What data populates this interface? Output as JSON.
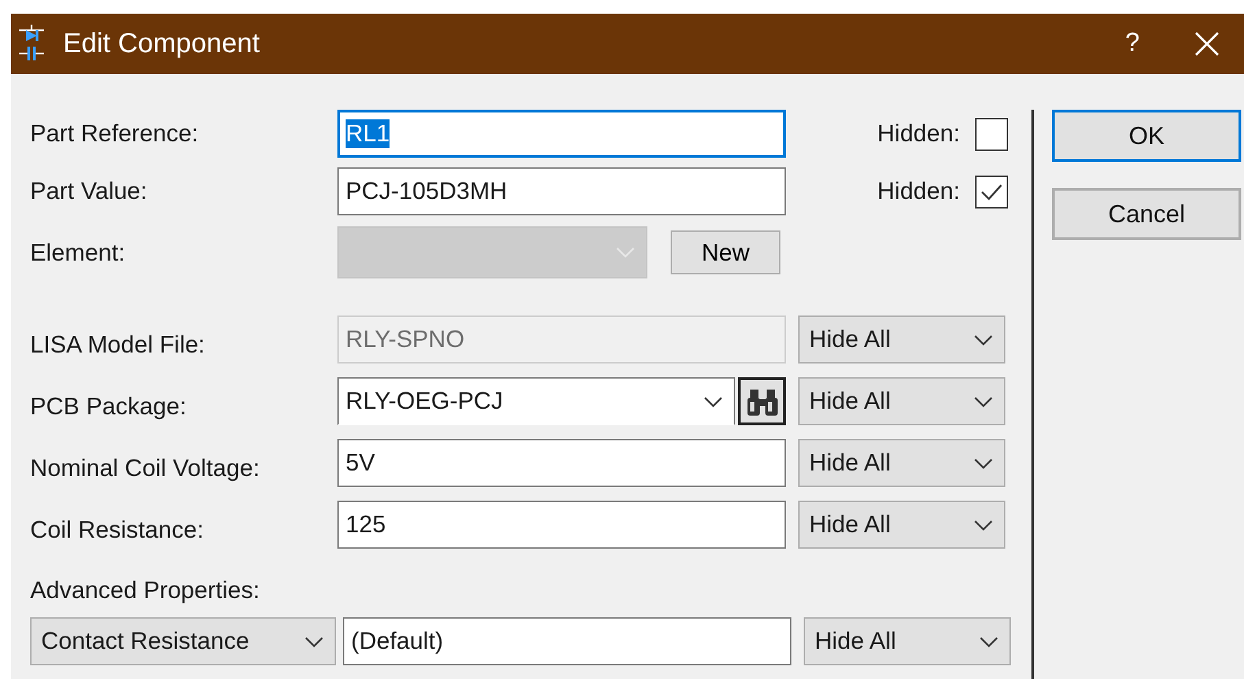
{
  "window": {
    "title": "Edit Component",
    "help": "?"
  },
  "top_rows": [
    {
      "label": "Part Reference:",
      "value": "RL1",
      "focused": true,
      "text_selected": true,
      "hidden_label": "Hidden:",
      "hidden": false
    },
    {
      "label": "Part Value:",
      "value": "PCJ-105D3MH",
      "focused": false,
      "text_selected": false,
      "hidden_label": "Hidden:",
      "hidden": true
    }
  ],
  "element": {
    "label": "Element:",
    "disabled": true,
    "button": "New"
  },
  "properties": [
    {
      "kind": "readonly",
      "label": "LISA Model File:",
      "value": "RLY-SPNO",
      "visibility": "Hide All"
    },
    {
      "kind": "package",
      "label": "PCB Package:",
      "value": "RLY-OEG-PCJ",
      "visibility": "Hide All"
    },
    {
      "kind": "text",
      "label": "Nominal Coil Voltage:",
      "value": "5V",
      "visibility": "Hide All"
    },
    {
      "kind": "text",
      "label": "Coil Resistance:",
      "value": "125",
      "visibility": "Hide All"
    }
  ],
  "advanced": {
    "label": "Advanced Properties:",
    "property": "Contact Resistance",
    "value": "(Default)",
    "visibility": "Hide All"
  },
  "buttons": [
    {
      "label": "OK",
      "default": true
    },
    {
      "label": "Cancel",
      "default": false
    }
  ]
}
